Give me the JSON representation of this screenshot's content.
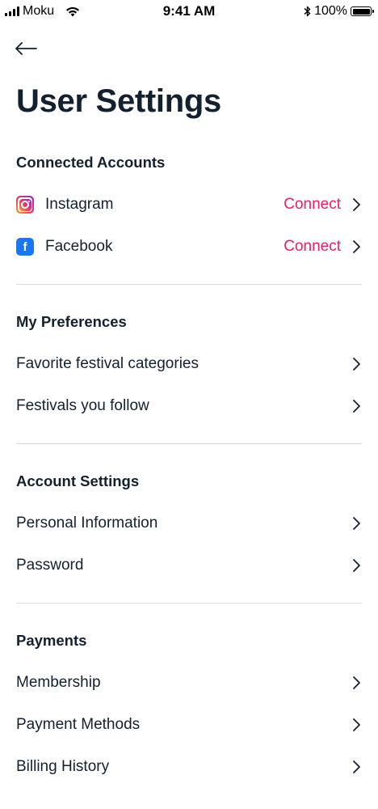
{
  "status_bar": {
    "carrier": "Moku",
    "time": "9:41 AM",
    "battery": "100%"
  },
  "header": {
    "title": "User Settings",
    "back_icon": "arrow-left-icon"
  },
  "sections": {
    "connected": {
      "heading": "Connected Accounts",
      "items": [
        {
          "label": "Instagram",
          "action": "Connect",
          "icon": "instagram-icon"
        },
        {
          "label": "Facebook",
          "action": "Connect",
          "icon": "facebook-icon"
        }
      ]
    },
    "preferences": {
      "heading": "My Preferences",
      "items": [
        {
          "label": "Favorite festival categories"
        },
        {
          "label": "Festivals you follow"
        }
      ]
    },
    "account": {
      "heading": "Account Settings",
      "items": [
        {
          "label": "Personal Information"
        },
        {
          "label": "Password"
        }
      ]
    },
    "payments": {
      "heading": "Payments",
      "items": [
        {
          "label": "Membership"
        },
        {
          "label": "Payment Methods"
        },
        {
          "label": "Billing History"
        }
      ]
    }
  },
  "colors": {
    "accent": "#e3206f",
    "text": "#13202e",
    "divider": "#dcdcdc",
    "facebook": "#1877f2"
  },
  "facebook_glyph": "f"
}
